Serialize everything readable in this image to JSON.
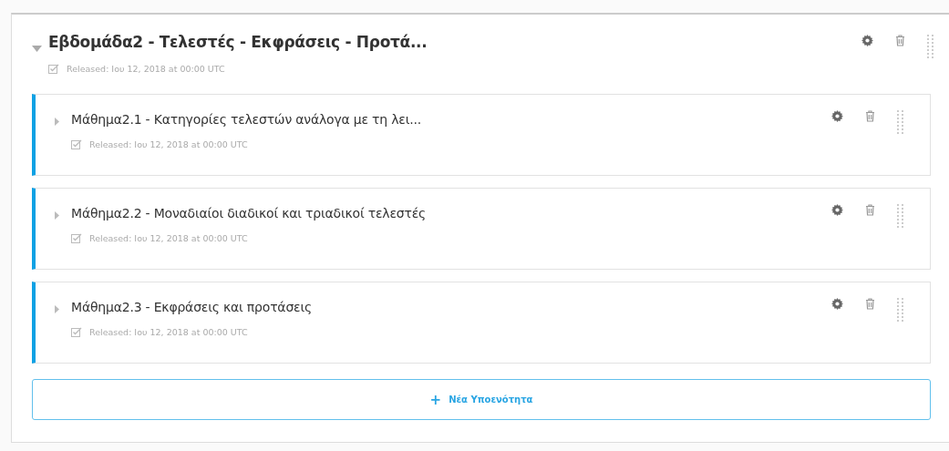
{
  "section": {
    "title": "Εβδομάδα2 - Τελεστές - Εκφράσεις - Προτά...",
    "expanded": true,
    "status": "Released: Ιου 12, 2018 at 00:00 UTC",
    "subsections": [
      {
        "title": "Μάθημα2.1 - Κατηγορίες τελεστών ανάλογα με τη λει...",
        "expanded": false,
        "status": "Released: Ιου 12, 2018 at 00:00 UTC"
      },
      {
        "title": "Μάθημα2.2 - Μοναδιαίοι διαδικοί και τριαδικοί τελεστές",
        "expanded": false,
        "status": "Released: Ιου 12, 2018 at 00:00 UTC"
      },
      {
        "title": "Μάθημα2.3 - Εκφράσεις και προτάσεις",
        "expanded": false,
        "status": "Released: Ιου 12, 2018 at 00:00 UTC"
      }
    ],
    "new_subsection_button": {
      "icon": "+",
      "label": "Νέα Υποενότητα"
    }
  }
}
